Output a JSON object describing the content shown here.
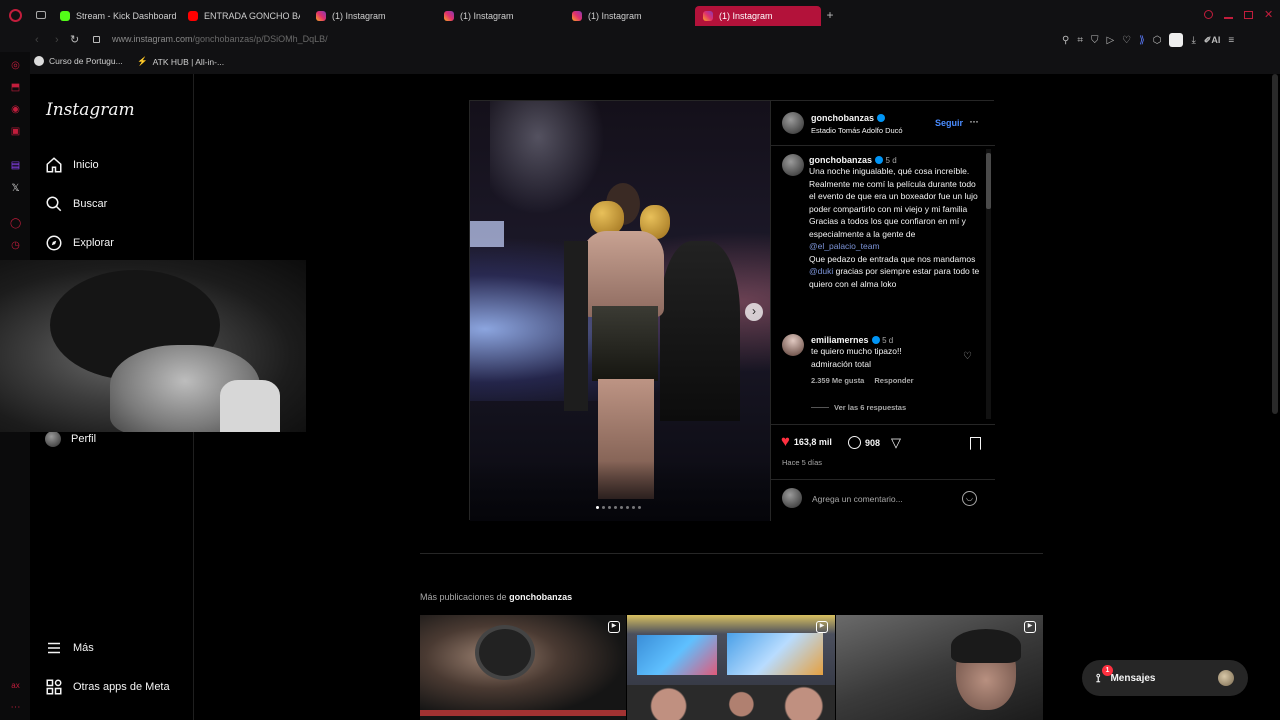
{
  "browser": {
    "tabs": [
      {
        "label": "Stream - Kick Dashboard",
        "icon": "kick-icon",
        "color": "#53fc18"
      },
      {
        "label": "ENTRADA GONCHO BANZ...",
        "icon": "youtube-icon",
        "color": "#ff0000"
      },
      {
        "label": "(1) Instagram",
        "icon": "instagram-icon",
        "color": "#e1306c"
      },
      {
        "label": "(1) Instagram",
        "icon": "instagram-icon",
        "color": "#e1306c"
      },
      {
        "label": "(1) Instagram",
        "icon": "instagram-icon",
        "color": "#e1306c"
      },
      {
        "label": "(1) Instagram",
        "icon": "instagram-icon",
        "color": "#e1306c",
        "active": true
      }
    ],
    "url_host": "www.instagram.com",
    "url_path": "/gonchobanzas/p/DSiOMh_DqLB/",
    "bookmarks": [
      {
        "label": "Curso de Portugu...",
        "icon": "bookmark-site-icon"
      },
      {
        "label": "ATK HUB | All-in-...",
        "icon": "lightning-icon"
      }
    ],
    "ai_label": "AI",
    "accent_color": "#b3123a"
  },
  "sidebar": {
    "logo": "Instagram",
    "items": [
      {
        "label": "Inicio",
        "icon": "home-icon"
      },
      {
        "label": "Buscar",
        "icon": "search-icon"
      },
      {
        "label": "Explorar",
        "icon": "compass-icon"
      },
      {
        "label": "Perfil",
        "icon": "profile-avatar-icon"
      }
    ],
    "bottom": [
      {
        "label": "Más",
        "icon": "menu-icon"
      },
      {
        "label": "Otras apps de Meta",
        "icon": "meta-apps-icon"
      }
    ]
  },
  "post": {
    "author": "gonchobanzas",
    "location": "Estadio Tomás Adolfo Ducó",
    "follow_label": "Seguir",
    "caption": {
      "username": "gonchobanzas",
      "time": "5 d",
      "text_1": "Una noche inigualable, qué cosa increíble. Realmente me comí la película durante todo el evento de que era un boxeador fue un lujo poder compartirlo con mi viejo y mi familia",
      "text_2": "Gracias a todos los que confiaron en mí y especialmente a la gente de",
      "mention_1": "@el_palacio_team",
      "text_3": "Que pedazo de entrada que nos mandamos",
      "mention_2": "@duki",
      "text_4": "gracias por siempre estar para todo te quiero con el alma loko"
    },
    "comment": {
      "username": "emiliamernes",
      "time": "5 d",
      "text": "te quiero mucho tipazo!! admiración total",
      "likes": "2.359 Me gusta",
      "reply_label": "Responder",
      "view_replies": "Ver las 6 respuestas"
    },
    "likes": "163,8 mil",
    "comments_count": "908",
    "posted": "Hace 5 días",
    "comment_placeholder": "Agrega un comentario...",
    "carousel_total": 8,
    "carousel_index": 1
  },
  "more": {
    "prefix": "Más publicaciones de",
    "username": "gonchobanzas"
  },
  "messages": {
    "label": "Mensajes",
    "badge": "1"
  }
}
